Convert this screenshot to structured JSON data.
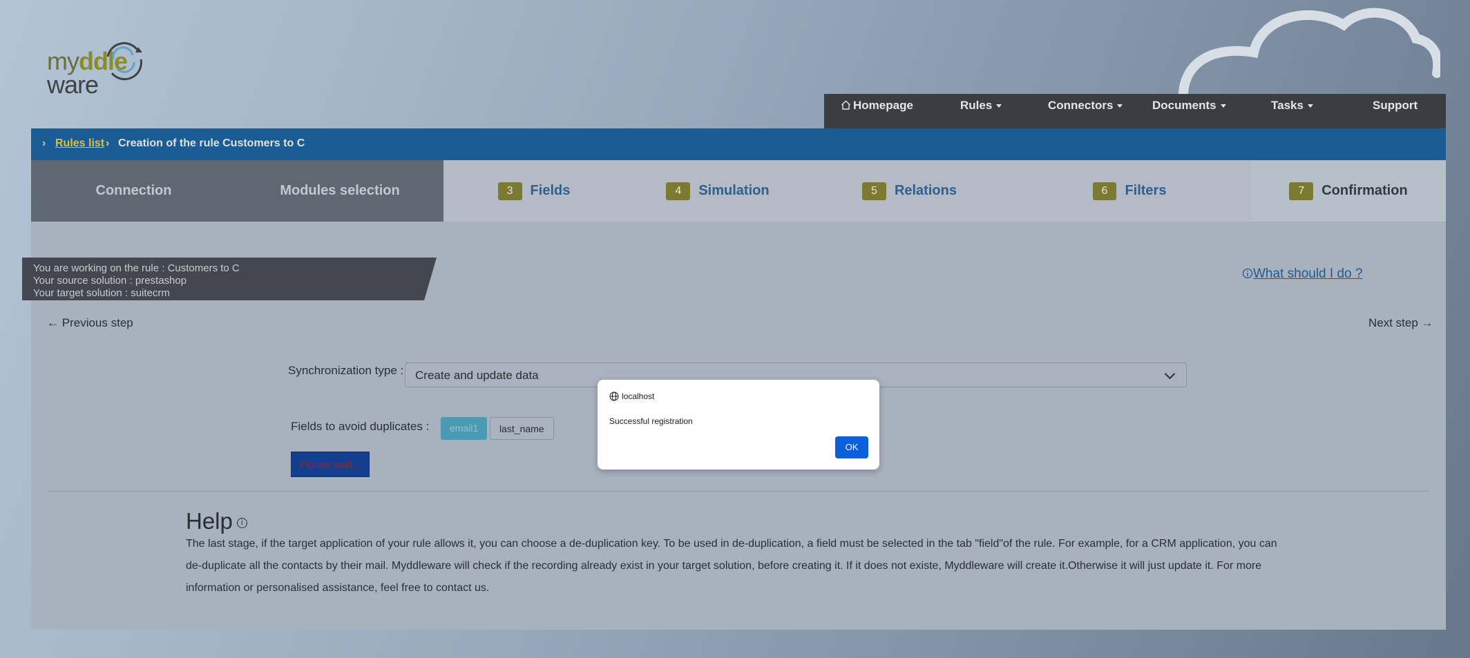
{
  "brand": {
    "logo_line1_a": "my",
    "logo_line1_b": "ddle",
    "logo_line2": "ware"
  },
  "nav": [
    {
      "label": "Homepage",
      "icon": "home-icon"
    },
    {
      "label": "Rules",
      "dropdown": true
    },
    {
      "label": "Connectors",
      "dropdown": true
    },
    {
      "label": "Documents",
      "dropdown": true
    },
    {
      "label": "Tasks",
      "dropdown": true
    },
    {
      "label": "Support"
    }
  ],
  "breadcrumb": {
    "link": "Rules list",
    "current": "Creation of the rule Customers to C"
  },
  "tabs": [
    {
      "label": "Connection",
      "state": "done"
    },
    {
      "label": "Modules selection",
      "state": "done"
    },
    {
      "num": "3",
      "label": "Fields",
      "state": "todo"
    },
    {
      "num": "4",
      "label": "Simulation",
      "state": "todo"
    },
    {
      "num": "5",
      "label": "Relations",
      "state": "todo"
    },
    {
      "num": "6",
      "label": "Filters",
      "state": "todo"
    },
    {
      "num": "7",
      "label": "Confirmation",
      "state": "active"
    }
  ],
  "rule_info": {
    "line1": "You are working on the rule : Customers to C",
    "line2": "Your source solution : prestashop",
    "line3": "Your target solution : suitecrm"
  },
  "help_link": "What should I do ?",
  "previous_step": "Previous step",
  "next_step": "Next step",
  "form": {
    "sync_label": "Synchronization type :",
    "sync_value": "Create and update data",
    "dup_label": "Fields to avoid duplicates :",
    "dup_fields": [
      "email1",
      "last_name"
    ],
    "wait_button": "Please wait..."
  },
  "help": {
    "title": "Help",
    "text": "The last stage, if the target application of your rule allows it, you can choose a de-duplication key. To be used in de-duplication, a field must be selected in the tab \"field\"of the rule. For example, for a CRM application, you can de-duplicate all the contacts by their mail. Myddleware will check if the recording already exist in your target solution, before creating it. If it does not existe, Myddleware will create it.Otherwise it will just update it. For more information or personalised assistance, feel free to contact us."
  },
  "dialog": {
    "host": "localhost",
    "message": "Successful registration",
    "ok": "OK"
  },
  "colors": {
    "nav_bg": "#3a3d42",
    "breadcrumb_bg": "#1a5d94",
    "badge": "#7b7a32",
    "ok_button": "#0b5fd8"
  }
}
